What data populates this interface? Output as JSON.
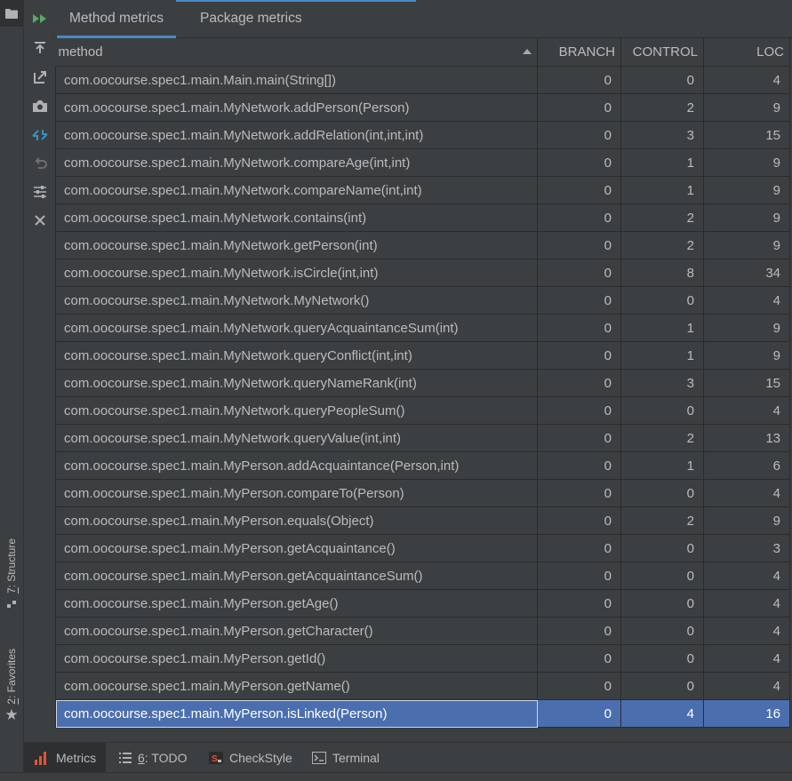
{
  "tabs": [
    {
      "label": "Method metrics",
      "active": true
    },
    {
      "label": "Package metrics",
      "active": false
    }
  ],
  "table": {
    "columns": [
      "method",
      "BRANCH",
      "CONTROL",
      "LOC"
    ],
    "rows": [
      {
        "method": "com.oocourse.spec1.main.Main.main(String[])",
        "branch": "0",
        "control": "0",
        "loc": "4"
      },
      {
        "method": "com.oocourse.spec1.main.MyNetwork.addPerson(Person)",
        "branch": "0",
        "control": "2",
        "loc": "9"
      },
      {
        "method": "com.oocourse.spec1.main.MyNetwork.addRelation(int,int,int)",
        "branch": "0",
        "control": "3",
        "loc": "15"
      },
      {
        "method": "com.oocourse.spec1.main.MyNetwork.compareAge(int,int)",
        "branch": "0",
        "control": "1",
        "loc": "9"
      },
      {
        "method": "com.oocourse.spec1.main.MyNetwork.compareName(int,int)",
        "branch": "0",
        "control": "1",
        "loc": "9"
      },
      {
        "method": "com.oocourse.spec1.main.MyNetwork.contains(int)",
        "branch": "0",
        "control": "2",
        "loc": "9"
      },
      {
        "method": "com.oocourse.spec1.main.MyNetwork.getPerson(int)",
        "branch": "0",
        "control": "2",
        "loc": "9"
      },
      {
        "method": "com.oocourse.spec1.main.MyNetwork.isCircle(int,int)",
        "branch": "0",
        "control": "8",
        "loc": "34"
      },
      {
        "method": "com.oocourse.spec1.main.MyNetwork.MyNetwork()",
        "branch": "0",
        "control": "0",
        "loc": "4"
      },
      {
        "method": "com.oocourse.spec1.main.MyNetwork.queryAcquaintanceSum(int)",
        "branch": "0",
        "control": "1",
        "loc": "9"
      },
      {
        "method": "com.oocourse.spec1.main.MyNetwork.queryConflict(int,int)",
        "branch": "0",
        "control": "1",
        "loc": "9"
      },
      {
        "method": "com.oocourse.spec1.main.MyNetwork.queryNameRank(int)",
        "branch": "0",
        "control": "3",
        "loc": "15"
      },
      {
        "method": "com.oocourse.spec1.main.MyNetwork.queryPeopleSum()",
        "branch": "0",
        "control": "0",
        "loc": "4"
      },
      {
        "method": "com.oocourse.spec1.main.MyNetwork.queryValue(int,int)",
        "branch": "0",
        "control": "2",
        "loc": "13"
      },
      {
        "method": "com.oocourse.spec1.main.MyPerson.addAcquaintance(Person,int)",
        "branch": "0",
        "control": "1",
        "loc": "6"
      },
      {
        "method": "com.oocourse.spec1.main.MyPerson.compareTo(Person)",
        "branch": "0",
        "control": "0",
        "loc": "4"
      },
      {
        "method": "com.oocourse.spec1.main.MyPerson.equals(Object)",
        "branch": "0",
        "control": "2",
        "loc": "9"
      },
      {
        "method": "com.oocourse.spec1.main.MyPerson.getAcquaintance()",
        "branch": "0",
        "control": "0",
        "loc": "3"
      },
      {
        "method": "com.oocourse.spec1.main.MyPerson.getAcquaintanceSum()",
        "branch": "0",
        "control": "0",
        "loc": "4"
      },
      {
        "method": "com.oocourse.spec1.main.MyPerson.getAge()",
        "branch": "0",
        "control": "0",
        "loc": "4"
      },
      {
        "method": "com.oocourse.spec1.main.MyPerson.getCharacter()",
        "branch": "0",
        "control": "0",
        "loc": "4"
      },
      {
        "method": "com.oocourse.spec1.main.MyPerson.getId()",
        "branch": "0",
        "control": "0",
        "loc": "4"
      },
      {
        "method": "com.oocourse.spec1.main.MyPerson.getName()",
        "branch": "0",
        "control": "0",
        "loc": "4"
      },
      {
        "method": "com.oocourse.spec1.main.MyPerson.isLinked(Person)",
        "branch": "0",
        "control": "4",
        "loc": "16",
        "selected": true
      }
    ]
  },
  "toolbar_icons": [
    "run-icon",
    "export-icon",
    "open-in-icon",
    "camera-icon",
    "collapse-icon",
    "undo-icon",
    "settings-icon",
    "close-icon"
  ],
  "left_strip": {
    "structure": {
      "key": "7",
      "label": ": Structure"
    },
    "favorites": {
      "key": "2",
      "label": ": Favorites"
    }
  },
  "bottom_tabs": [
    {
      "key": "",
      "label": "Metrics",
      "icon": "metrics-bar-icon",
      "active": true
    },
    {
      "key": "6",
      "label": ": TODO",
      "icon": "todo-list-icon",
      "active": false
    },
    {
      "key": "",
      "label": "CheckStyle",
      "icon": "checkstyle-icon",
      "active": false
    },
    {
      "key": "",
      "label": "Terminal",
      "icon": "terminal-icon",
      "active": false
    }
  ],
  "colors": {
    "background": "#3c3f41",
    "accent": "#4a88c7",
    "selection": "#4b6eaf",
    "run_green": "#59a869",
    "metrics_red": "#e05535"
  }
}
